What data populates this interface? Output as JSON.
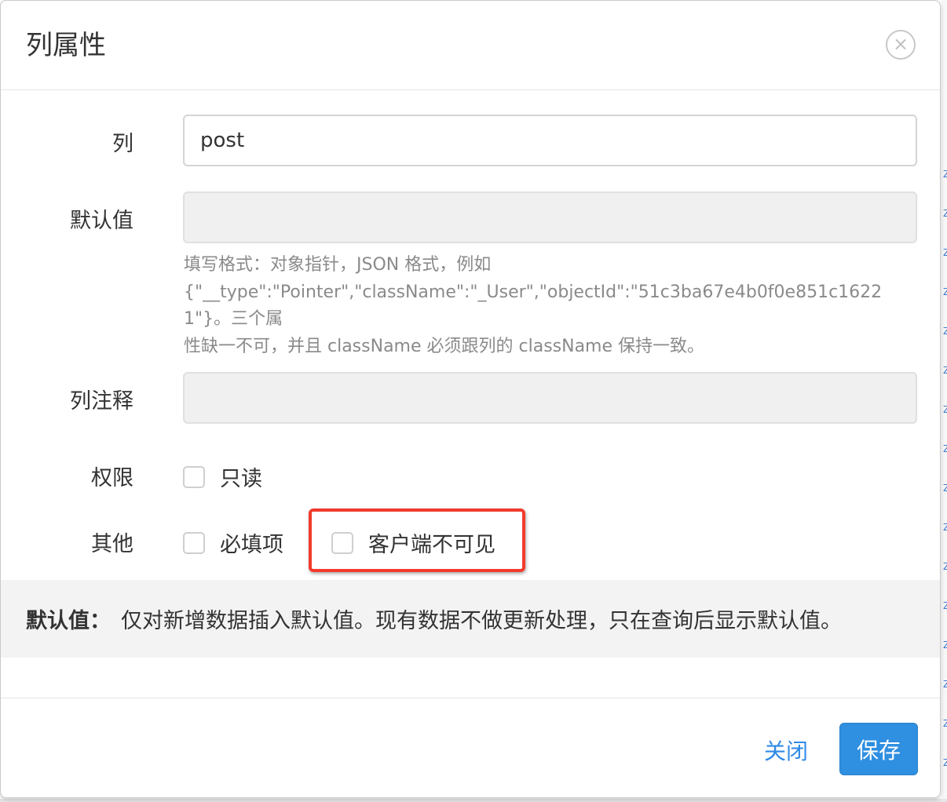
{
  "dialog": {
    "title": "列属性",
    "close_icon": "×"
  },
  "fields": {
    "column": {
      "label": "列",
      "value": "post"
    },
    "default_value": {
      "label": "默认值",
      "value": "",
      "help_line1": "填写格式：对象指针，JSON 格式，例如",
      "help_line2": "{\"__type\":\"Pointer\",\"className\":\"_User\",\"objectId\":\"51c3ba67e4b0f0e851c16221\"}。三个属",
      "help_line3": "性缺一不可，并且 className 必须跟列的 className 保持一致。"
    },
    "comment": {
      "label": "列注释",
      "value": ""
    },
    "permission": {
      "label": "权限",
      "readonly_label": "只读"
    },
    "other": {
      "label": "其他",
      "required_label": "必填项",
      "client_invisible_label": "客户端不可见"
    }
  },
  "note": {
    "label": "默认值：",
    "text": "仅对新增数据插入默认值。现有数据不做更新处理，只在查询后显示默认值。"
  },
  "footer": {
    "close_label": "关闭",
    "save_label": "保存"
  },
  "colors": {
    "primary": "#2f8fe0",
    "link": "#2f8ae6",
    "highlight": "#f23b2c"
  }
}
